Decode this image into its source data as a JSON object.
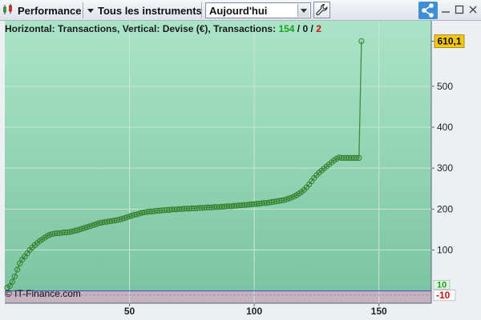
{
  "toolbar": {
    "performance_label": "Performance",
    "instruments_label": "Tous les instruments",
    "period_value": "Aujourd'hui"
  },
  "header": {
    "prefix": "Horizontal: Transactions, Vertical: Devise (€), Transactions: ",
    "count_green": "154",
    "slash1": " / ",
    "count_zero": "0",
    "slash2": " / ",
    "count_red": "2"
  },
  "watermark": "© IT-Finance.com",
  "colors": {
    "profit_zone": "#a9e1c5",
    "loss_zone": "#c7b2c0",
    "curve_line": "#3f8e3a",
    "marker_stroke": "#2f7d2a",
    "last_value_badge": "#f5c518",
    "loss_label_color": "#d01010",
    "profit_label_color": "#1e9e1e",
    "zero_line": "#3b4fc4"
  },
  "chart_data": {
    "type": "line",
    "title": "",
    "xlabel": "Transactions",
    "ylabel": "Devise (€)",
    "xlim": [
      0,
      171
    ],
    "ylim": [
      -30,
      660
    ],
    "grid": true,
    "x_ticks": [
      "50",
      "100",
      "150"
    ],
    "y_ticks": [
      "100",
      "200",
      "300",
      "400",
      "500"
    ],
    "last_value_label": "610,1",
    "threshold_labels": {
      "upper": "10",
      "lower": "-10"
    },
    "thresholds": [
      10,
      -10
    ],
    "series": [
      {
        "points": [
          [
            1,
            8
          ],
          [
            2,
            12
          ],
          [
            3,
            22
          ],
          [
            4,
            35
          ],
          [
            5,
            52
          ],
          [
            6,
            67
          ],
          [
            7,
            77
          ],
          [
            8,
            84
          ],
          [
            9,
            92
          ],
          [
            10,
            100
          ],
          [
            11,
            106
          ],
          [
            12,
            112
          ],
          [
            13,
            117
          ],
          [
            14,
            122
          ],
          [
            15,
            126
          ],
          [
            16,
            130
          ],
          [
            17,
            134
          ],
          [
            18,
            137
          ],
          [
            19,
            139
          ],
          [
            20,
            140
          ],
          [
            21,
            141
          ],
          [
            22,
            141
          ],
          [
            23,
            142
          ],
          [
            24,
            143
          ],
          [
            25,
            143
          ],
          [
            26,
            144
          ],
          [
            27,
            145
          ],
          [
            28,
            147
          ],
          [
            29,
            148
          ],
          [
            30,
            150
          ],
          [
            31,
            152
          ],
          [
            32,
            154
          ],
          [
            33,
            156
          ],
          [
            34,
            158
          ],
          [
            35,
            160
          ],
          [
            36,
            162
          ],
          [
            37,
            164
          ],
          [
            38,
            166
          ],
          [
            39,
            167
          ],
          [
            40,
            168
          ],
          [
            41,
            169
          ],
          [
            42,
            170
          ],
          [
            43,
            171
          ],
          [
            44,
            172
          ],
          [
            45,
            173
          ],
          [
            46,
            174
          ],
          [
            47,
            176
          ],
          [
            48,
            178
          ],
          [
            49,
            180
          ],
          [
            50,
            182
          ],
          [
            51,
            184
          ],
          [
            52,
            186
          ],
          [
            53,
            187
          ],
          [
            54,
            189
          ],
          [
            55,
            191
          ],
          [
            56,
            192
          ],
          [
            57,
            193
          ],
          [
            58,
            194
          ],
          [
            59,
            194
          ],
          [
            60,
            195
          ],
          [
            61,
            196
          ],
          [
            62,
            196
          ],
          [
            63,
            197
          ],
          [
            64,
            197
          ],
          [
            65,
            198
          ],
          [
            66,
            198
          ],
          [
            67,
            199
          ],
          [
            68,
            199
          ],
          [
            69,
            199
          ],
          [
            70,
            200
          ],
          [
            71,
            200
          ],
          [
            72,
            201
          ],
          [
            73,
            201
          ],
          [
            74,
            201
          ],
          [
            75,
            202
          ],
          [
            76,
            202
          ],
          [
            77,
            202
          ],
          [
            78,
            203
          ],
          [
            79,
            203
          ],
          [
            80,
            203
          ],
          [
            81,
            204
          ],
          [
            82,
            204
          ],
          [
            83,
            204
          ],
          [
            84,
            205
          ],
          [
            85,
            205
          ],
          [
            86,
            205
          ],
          [
            87,
            206
          ],
          [
            88,
            206
          ],
          [
            89,
            207
          ],
          [
            90,
            207
          ],
          [
            91,
            207
          ],
          [
            92,
            208
          ],
          [
            93,
            208
          ],
          [
            94,
            209
          ],
          [
            95,
            209
          ],
          [
            96,
            210
          ],
          [
            97,
            210
          ],
          [
            98,
            211
          ],
          [
            99,
            212
          ],
          [
            100,
            212
          ],
          [
            101,
            213
          ],
          [
            102,
            213
          ],
          [
            103,
            214
          ],
          [
            104,
            215
          ],
          [
            105,
            215
          ],
          [
            106,
            216
          ],
          [
            107,
            217
          ],
          [
            108,
            218
          ],
          [
            109,
            219
          ],
          [
            110,
            220
          ],
          [
            111,
            221
          ],
          [
            112,
            222
          ],
          [
            113,
            224
          ],
          [
            114,
            226
          ],
          [
            115,
            228
          ],
          [
            116,
            231
          ],
          [
            117,
            234
          ],
          [
            118,
            238
          ],
          [
            119,
            242
          ],
          [
            120,
            247
          ],
          [
            121,
            253
          ],
          [
            122,
            260
          ],
          [
            123,
            268
          ],
          [
            124,
            276
          ],
          [
            125,
            283
          ],
          [
            126,
            289
          ],
          [
            127,
            294
          ],
          [
            128,
            299
          ],
          [
            129,
            304
          ],
          [
            130,
            309
          ],
          [
            131,
            314
          ],
          [
            132,
            319
          ],
          [
            133,
            323
          ],
          [
            134,
            326
          ],
          [
            135,
            325
          ],
          [
            136,
            325
          ],
          [
            137,
            325
          ],
          [
            138,
            325
          ],
          [
            139,
            325
          ],
          [
            140,
            325
          ],
          [
            141,
            325
          ],
          [
            142,
            325
          ],
          [
            143,
            610.1
          ]
        ]
      }
    ]
  }
}
